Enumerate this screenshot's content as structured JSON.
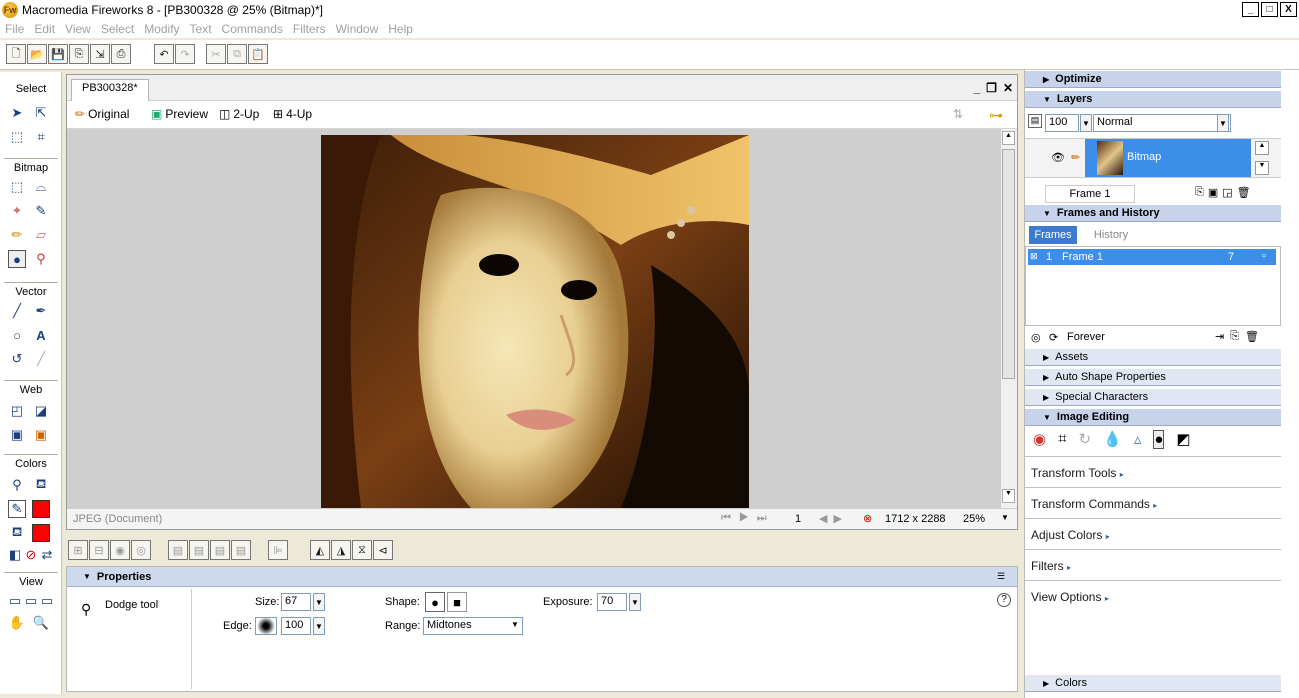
{
  "window": {
    "title": "Macromedia Fireworks 8 - [PB300328 @  25% (Bitmap)*]",
    "controls": [
      "_",
      "□",
      "X"
    ]
  },
  "menu": [
    "File",
    "Edit",
    "View",
    "Select",
    "Modify",
    "Text",
    "Commands",
    "Filters",
    "Window",
    "Help"
  ],
  "tools": {
    "sections": [
      "Select",
      "Bitmap",
      "Vector",
      "Web",
      "Colors",
      "View"
    ]
  },
  "document": {
    "tab": "PB300328*",
    "views": [
      "Original",
      "Preview",
      "2-Up",
      "4-Up"
    ],
    "status_type": "JPEG (Document)",
    "frame_number": "1",
    "size": "1712 x 2288",
    "zoom": "25%"
  },
  "properties": {
    "header": "Properties",
    "tool_name": "Dodge tool",
    "size_label": "Size:",
    "size_value": "67",
    "edge_label": "Edge:",
    "edge_value": "100",
    "shape_label": "Shape:",
    "range_label": "Range:",
    "range_value": "Midtones",
    "exposure_label": "Exposure:",
    "exposure_value": "70"
  },
  "panels": {
    "optimize": "Optimize",
    "layers": "Layers",
    "opacity": "100",
    "blend": "Normal",
    "layer_name": "Bitmap",
    "frame_label": "Frame 1",
    "frames_history": "Frames and History",
    "tab_frames": "Frames",
    "tab_history": "History",
    "frame_row_num": "1",
    "frame_row_name": "Frame 1",
    "frame_row_delay": "7",
    "loop": "Forever",
    "assets": "Assets",
    "auto_shape": "Auto Shape Properties",
    "special_chars": "Special Characters",
    "image_editing": "Image Editing",
    "transform_tools": "Transform Tools",
    "transform_commands": "Transform Commands",
    "adjust_colors": "Adjust Colors",
    "filters": "Filters",
    "view_options": "View Options",
    "colors": "Colors"
  }
}
